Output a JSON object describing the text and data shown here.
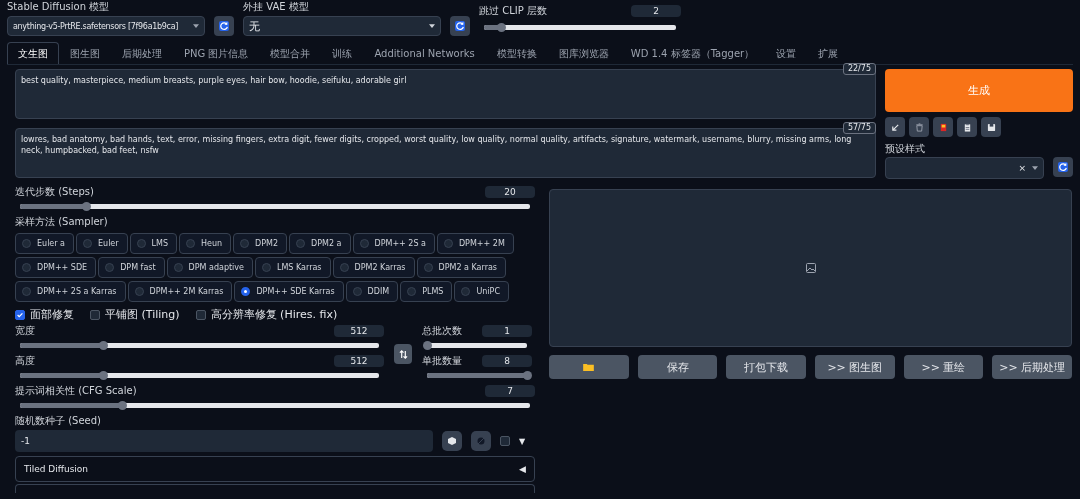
{
  "model": {
    "label": "Stable Diffusion 模型",
    "value": "anything-v5-PrtRE.safetensors [7f96a1b9ca]"
  },
  "vae": {
    "label": "外挂 VAE 模型",
    "value": "无"
  },
  "clip": {
    "label": "跳过 CLIP 层数",
    "value": "2",
    "level": 0.09
  },
  "tabs": [
    {
      "label": "文生图",
      "selected": true
    },
    {
      "label": "图生图",
      "selected": false
    },
    {
      "label": "后期处理",
      "selected": false
    },
    {
      "label": "PNG 图片信息",
      "selected": false
    },
    {
      "label": "模型合并",
      "selected": false
    },
    {
      "label": "训练",
      "selected": false
    },
    {
      "label": "Additional Networks",
      "selected": false
    },
    {
      "label": "模型转换",
      "selected": false
    },
    {
      "label": "图库浏览器",
      "selected": false
    },
    {
      "label": "WD 1.4 标签器（Tagger）",
      "selected": false
    },
    {
      "label": "设置",
      "selected": false
    },
    {
      "label": "扩展",
      "selected": false
    }
  ],
  "prompt": {
    "text": "best quality, masterpiece, medium breasts, purple eyes, hair bow, hoodie, seifuku, adorable girl",
    "counter": "22/75"
  },
  "negative_prompt": {
    "text": "lowres, bad anatomy, bad hands, text, error, missing fingers, extra digit, fewer digits, cropped, worst quality, low quality, normal quality, artifacts, signature, watermark, username, blurry, missing arms, long neck, humpbacked, bad feet, nsfw",
    "counter": "57/75"
  },
  "generate": {
    "label": "生成"
  },
  "styles": {
    "label": "预设样式",
    "clear": "×"
  },
  "steps": {
    "label": "迭代步数 (Steps)",
    "value": "20",
    "level": 0.13
  },
  "sampler": {
    "label": "采样方法 (Sampler)",
    "options": [
      {
        "label": "Euler a",
        "selected": false
      },
      {
        "label": "Euler",
        "selected": false
      },
      {
        "label": "LMS",
        "selected": false
      },
      {
        "label": "Heun",
        "selected": false
      },
      {
        "label": "DPM2",
        "selected": false
      },
      {
        "label": "DPM2 a",
        "selected": false
      },
      {
        "label": "DPM++ 2S a",
        "selected": false
      },
      {
        "label": "DPM++ 2M",
        "selected": false
      },
      {
        "label": "DPM++ SDE",
        "selected": false
      },
      {
        "label": "DPM fast",
        "selected": false
      },
      {
        "label": "DPM adaptive",
        "selected": false
      },
      {
        "label": "LMS Karras",
        "selected": false
      },
      {
        "label": "DPM2 Karras",
        "selected": false
      },
      {
        "label": "DPM2 a Karras",
        "selected": false
      },
      {
        "label": "DPM++ 2S a Karras",
        "selected": false
      },
      {
        "label": "DPM++ 2M Karras",
        "selected": false
      },
      {
        "label": "DPM++ SDE Karras",
        "selected": true
      },
      {
        "label": "DDIM",
        "selected": false
      },
      {
        "label": "PLMS",
        "selected": false
      },
      {
        "label": "UniPC",
        "selected": false
      }
    ]
  },
  "options": [
    {
      "label": "面部修复",
      "checked": true
    },
    {
      "label": "平铺图 (Tiling)",
      "checked": false
    },
    {
      "label": "高分辨率修复 (Hires. fix)",
      "checked": false
    }
  ],
  "width": {
    "label": "宽度",
    "value": "512",
    "level": 0.23
  },
  "height": {
    "label": "高度",
    "value": "512",
    "level": 0.23
  },
  "batch_count": {
    "label": "总批次数",
    "value": "1",
    "level": 0
  },
  "batch_size": {
    "label": "单批数量",
    "value": "8",
    "level": 1
  },
  "cfg": {
    "label": "提示词相关性 (CFG Scale)",
    "value": "7",
    "level": 0.2
  },
  "seed": {
    "label": "随机数种子 (Seed)",
    "value": "-1",
    "extra_checked": false,
    "toggle": "▼"
  },
  "accordion": {
    "title": "Tiled Diffusion",
    "expanded": false,
    "toggle": "◀"
  },
  "output_buttons": [
    {
      "kind": "folder"
    },
    {
      "kind": "text",
      "label": "保存"
    },
    {
      "kind": "text",
      "label": "打包下载"
    },
    {
      "kind": "text",
      "label": ">> 图生图"
    },
    {
      "kind": "text",
      "label": ">> 重绘"
    },
    {
      "kind": "text",
      "label": ">> 后期处理"
    }
  ]
}
